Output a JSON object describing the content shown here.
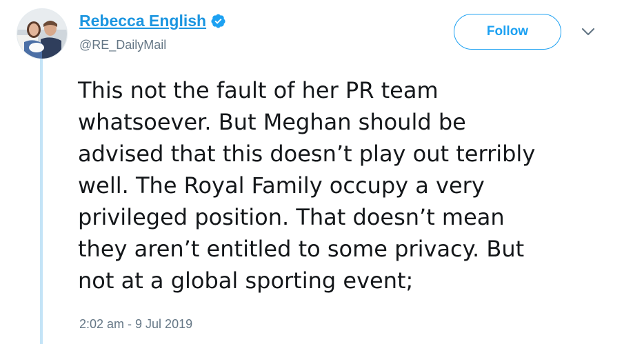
{
  "author": {
    "display_name": "Rebecca English",
    "handle": "@RE_DailyMail",
    "verified_icon": "verified-badge-icon",
    "avatar_icon": "profile-photo"
  },
  "actions": {
    "follow_label": "Follow",
    "menu_icon": "chevron-down-icon"
  },
  "tweet": {
    "lines": [
      "This not the fault of her PR team",
      "whatsoever. But Meghan should be",
      "advised that this doesn’t play out terribly",
      "well. The Royal Family occupy a very",
      "privileged position. That doesn’t mean",
      "they aren’t entitled to some privacy. But",
      "not at a global sporting event;"
    ],
    "timestamp": "2:02 am - 9 Jul 2019"
  },
  "colors": {
    "accent": "#1da1f2",
    "name_link": "#1b95e0",
    "thread_line": "#c4e4f7",
    "secondary_text": "#657786",
    "primary_text": "#14171a"
  }
}
